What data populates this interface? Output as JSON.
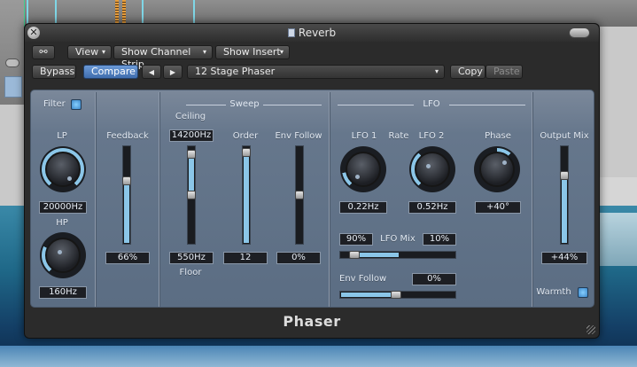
{
  "window": {
    "title": "Reverb",
    "close_symbol": "✕"
  },
  "toolbar": {
    "view_label": "View",
    "show_channel_strip_label": "Show Channel Strip",
    "show_insert_label": "Show Insert",
    "bypass_label": "Bypass",
    "compare_label": "Compare",
    "prev_symbol": "◀",
    "next_symbol": "▶",
    "preset_value": "12 Stage Phaser",
    "copy_label": "Copy",
    "paste_label": "Paste",
    "dropdown_arrow": "▾"
  },
  "plugin": {
    "name": "Phaser",
    "filter": {
      "label": "Filter",
      "enabled": true,
      "lp_label": "LP",
      "lp_value": "20000Hz",
      "hp_label": "HP",
      "hp_value": "160Hz"
    },
    "feedback": {
      "label": "Feedback",
      "value": "66%",
      "level": 0.66
    },
    "sweep": {
      "header": "Sweep",
      "ceiling_label": "Ceiling",
      "ceiling_value": "14200Hz",
      "floor_label": "Floor",
      "floor_value": "550Hz",
      "order_label": "Order",
      "order_value": "12",
      "env_follow_label": "Env Follow",
      "env_follow_value": "0%"
    },
    "lfo": {
      "header": "LFO",
      "lfo1_label": "LFO 1",
      "rate_label": "Rate",
      "lfo2_label": "LFO 2",
      "phase_label": "Phase",
      "lfo1_value": "0.22Hz",
      "lfo2_value": "0.52Hz",
      "phase_value": "+40°",
      "mix_label": "LFO Mix",
      "mix_left_value": "90%",
      "mix_right_value": "10%",
      "env_follow_label": "Env Follow",
      "env_follow_value": "0%"
    },
    "output": {
      "label": "Output Mix",
      "value": "+44%",
      "warmth_label": "Warmth",
      "warmth_enabled": true
    }
  },
  "colors": {
    "accent": "#8bc6e8",
    "panel": "#66778c",
    "compare": "#4f7fc2"
  }
}
